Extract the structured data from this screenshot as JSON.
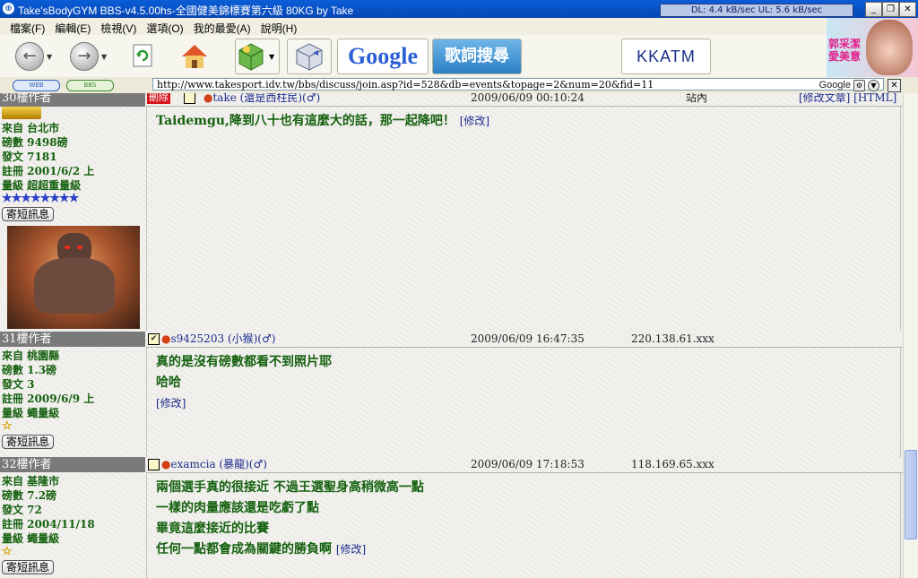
{
  "window": {
    "title": "Take'sBodyGYM BBS-v4.5.00hs-全國健美錦標賽第六級 80KG by Take",
    "netmeter": "DL: 4.4 kB/sec  UL: 5.6 kB/sec"
  },
  "menu": {
    "items": [
      "檔案(F)",
      "編輯(E)",
      "檢視(V)",
      "選項(O)",
      "我的最愛(A)",
      "說明(H)"
    ]
  },
  "toolbar": {
    "google_label": "Google",
    "lyrics_label": "歌詞搜尋",
    "kkatm_label": "KKATM"
  },
  "ad": {
    "text": "郭采潔 愛美意"
  },
  "address": {
    "web_label": "WEB",
    "bbs_label": "BBS",
    "url": "http://www.takesport.idv.tw/bbs/discuss/join.asp?id=528&db=events&topage=2&num=20&fid=11",
    "search_label": "Google"
  },
  "posts": [
    {
      "floor": "30樓作者",
      "header_user": "take (還是西柱民)",
      "header_gender": "(♂)",
      "header_date": "2009/06/09 00:10:24",
      "header_location": "站內",
      "header_actions": "[修改文章] [HTML]",
      "header_delete": "刪除",
      "info": [
        "來自 台北市",
        "磅數 9498磅",
        "發文 7181",
        "註冊 2001/6/2 上",
        "量級 超超重量級"
      ],
      "stars": "★★★★★★★★",
      "msg_label": "寄短訊息",
      "lines": [
        "Taidemgu,降到八十也有這麼大的話，那一起降吧！"
      ],
      "edit": "[修改]"
    },
    {
      "floor": "31樓作者",
      "header_user": "s9425203 (小猴)",
      "header_gender": "(♂)",
      "header_date": "2009/06/09 16:47:35",
      "header_ip": "220.138.61.xxx",
      "info": [
        "來自 桃園縣",
        "磅數 1.3磅",
        "發文 3",
        "註冊 2009/6/9 上",
        "量級 蠅量級"
      ],
      "stars": "☆",
      "msg_label": "寄短訊息",
      "lines": [
        "真的是沒有磅數都看不到照片耶",
        "哈哈"
      ],
      "edit": "[修改]"
    },
    {
      "floor": "32樓作者",
      "header_user": "examcia (暴龍)",
      "header_gender": "(♂)",
      "header_date": "2009/06/09 17:18:53",
      "header_ip": "118.169.65.xxx",
      "info": [
        "來自 基隆市",
        "磅數 7.2磅",
        "發文 72",
        "註冊 2004/11/18",
        "量級 蠅量級"
      ],
      "stars": "☆",
      "msg_label": "寄短訊息",
      "lines": [
        "兩個選手真的很接近 不過王選聖身高稍微高一點",
        "一樣的肉量應該還是吃虧了點",
        "畢竟這麼接近的比賽",
        "任何一點都會成為關鍵的勝負啊"
      ],
      "edit": "[修改]"
    }
  ]
}
